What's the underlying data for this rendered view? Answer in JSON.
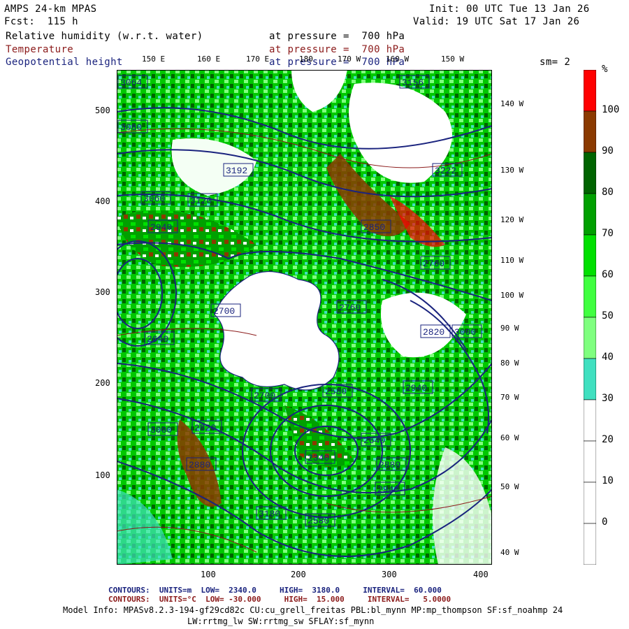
{
  "header": {
    "title": "AMPS 24-km MPAS",
    "fcst": "Fcst:  115 h",
    "init": "Init: 00 UTC Tue 13 Jan 26",
    "valid": "Valid: 19 UTC Sat 17 Jan 26",
    "sm": "sm= 2"
  },
  "fields": [
    {
      "name": "Relative humidity (w.r.t. water)",
      "level": "at pressure =  700 hPa",
      "color": "#000000"
    },
    {
      "name": "Temperature",
      "level": "at pressure =  700 hPa",
      "color": "#8b1a1a"
    },
    {
      "name": "Geopotential height",
      "level": "at pressure =  700 hPa",
      "color": "#1a237e"
    }
  ],
  "lon_labels_top": [
    "150 E",
    "160 E",
    "170 E",
    "180",
    "170 W",
    "160 W",
    "150 W"
  ],
  "lon_labels_right": [
    "140 W",
    "130 W",
    "120 W",
    "110 W",
    "100 W",
    "90 W",
    "80 W",
    "70 W",
    "60 W",
    "50 W",
    "40 W"
  ],
  "y_ticks": [
    "500",
    "400",
    "300",
    "200",
    "100"
  ],
  "x_ticks": [
    "100",
    "200",
    "300",
    "400"
  ],
  "height_labels": [
    "3064",
    "3080",
    "3156",
    "3192",
    "3222",
    "3060",
    "3120",
    "2940",
    "2850",
    "2760",
    "2700",
    "2580",
    "2640",
    "3000",
    "2820",
    "2880",
    "2940",
    "3180",
    "2700",
    "2760",
    "2820",
    "2880",
    "2940",
    "3000",
    "2640",
    "2580",
    "2340"
  ],
  "colorbar": {
    "unit": "%",
    "labels": [
      "100",
      "90",
      "80",
      "70",
      "60",
      "50",
      "40",
      "30",
      "20",
      "10",
      "0"
    ],
    "colors": [
      "#ff0000",
      "#8b3a00",
      "#006400",
      "#00a000",
      "#00e000",
      "#40ff40",
      "#7fff7f",
      "#40e0c0",
      "#ffffff",
      "#ffffff",
      "#ffffff",
      "#ffffff"
    ]
  },
  "footer": {
    "line1": "CONTOURS:  UNITS=m  LOW=  2340.0     HIGH=  3180.0     INTERVAL=  60.000",
    "line2": "CONTOURS:  UNITS=°C  LOW= -30.000     HIGH=  15.000     INTERVAL=   5.0000",
    "model1": "Model Info: MPASv8.2.3-194-gf29cd82c CU:cu_grell_freitas PBL:bl_mynn MP:mp_thompson SF:sf_noahmp 24",
    "model2": "LW:rrtmg_lw SW:rrtmg_sw SFLAY:sf_mynn"
  }
}
